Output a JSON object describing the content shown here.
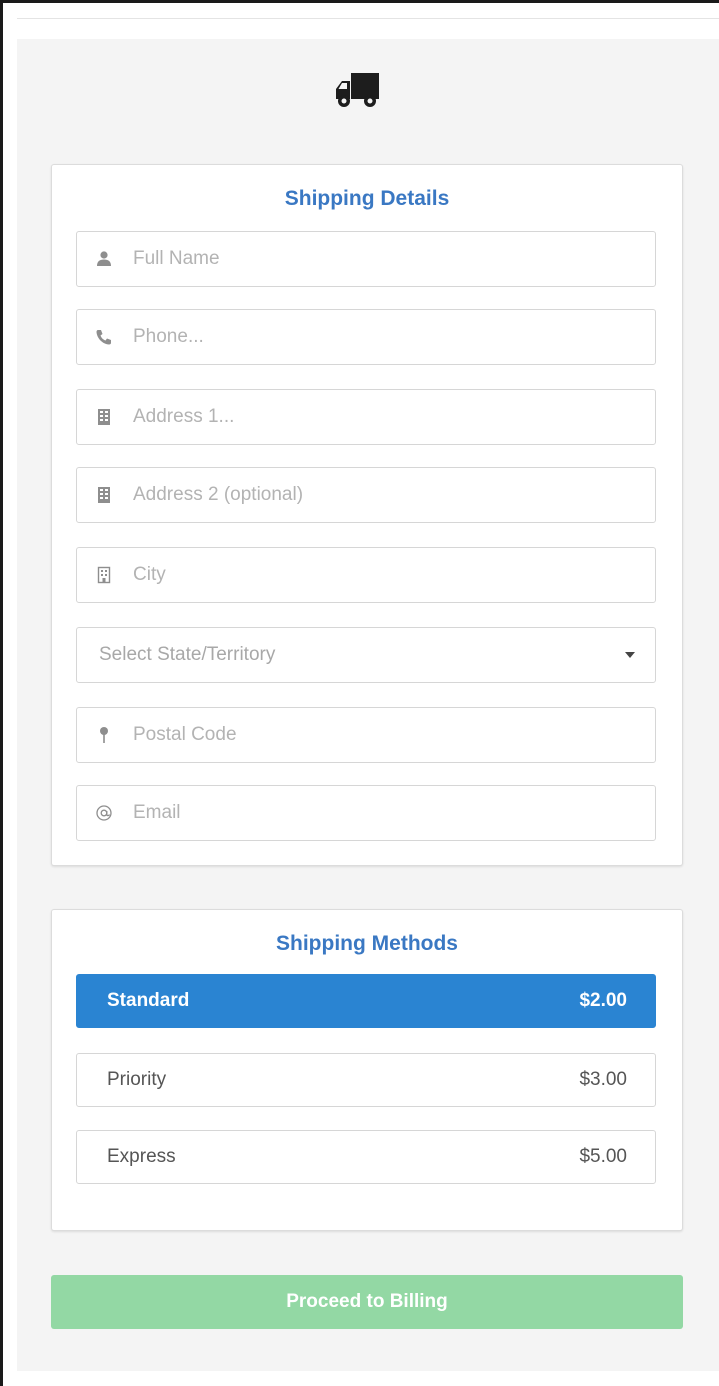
{
  "shipping_details": {
    "title": "Shipping Details",
    "fields": {
      "full_name": {
        "placeholder": "Full Name",
        "icon": "user-icon"
      },
      "phone": {
        "placeholder": "Phone...",
        "icon": "phone-icon"
      },
      "address1": {
        "placeholder": "Address 1...",
        "icon": "building-icon"
      },
      "address2": {
        "placeholder": "Address 2 (optional)",
        "icon": "building-icon"
      },
      "city": {
        "placeholder": "City",
        "icon": "city-building-icon"
      },
      "state": {
        "selected": "Select State/Territory"
      },
      "postal_code": {
        "placeholder": "Postal Code",
        "icon": "map-pin-icon"
      },
      "email": {
        "placeholder": "Email",
        "icon": "at-sign-icon"
      }
    }
  },
  "shipping_methods": {
    "title": "Shipping Methods",
    "items": [
      {
        "name": "Standard",
        "price": "$2.00",
        "active": true
      },
      {
        "name": "Priority",
        "price": "$3.00",
        "active": false
      },
      {
        "name": "Express",
        "price": "$5.00",
        "active": false
      }
    ]
  },
  "proceed_label": "Proceed to Billing",
  "colors": {
    "accent": "#3a78c3",
    "active_method": "#2a84d2",
    "proceed_button": "#93d8a4",
    "background": "#f4f4f4"
  },
  "icons": {
    "header": "truck-icon"
  }
}
